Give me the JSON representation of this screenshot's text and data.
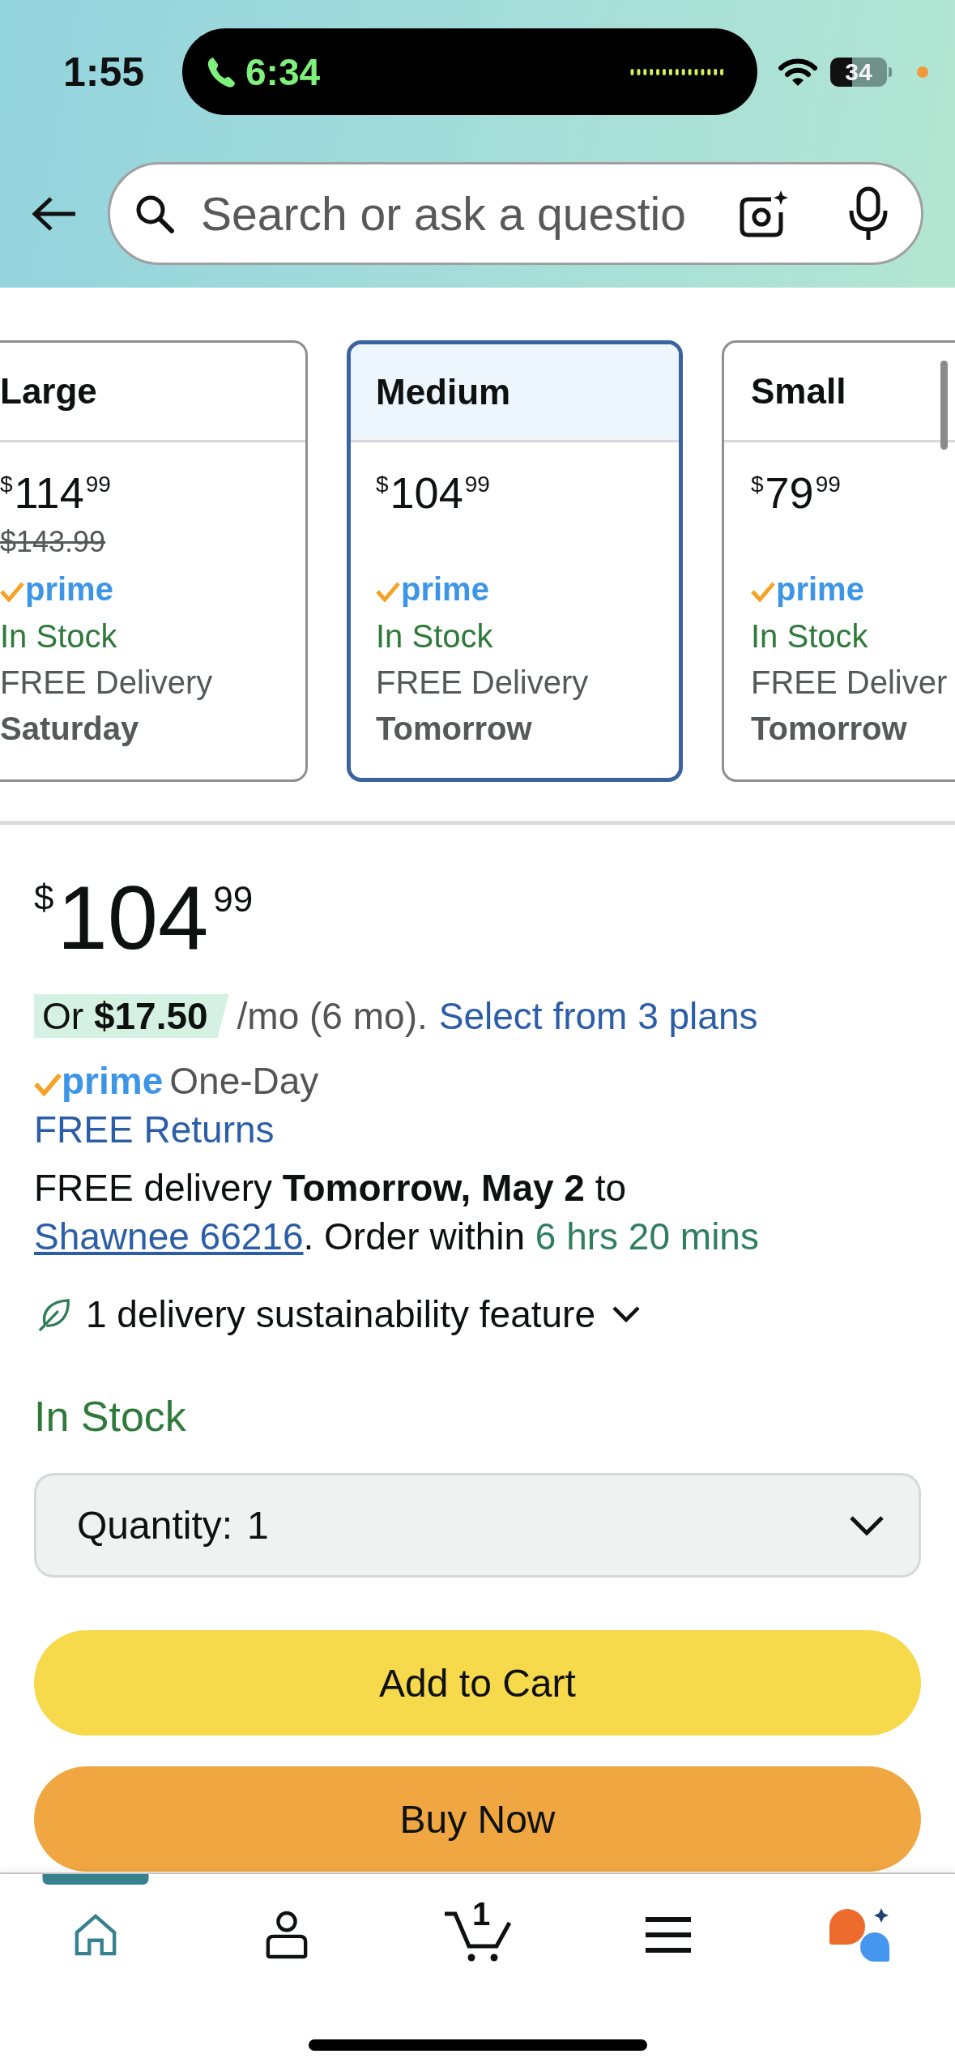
{
  "status_bar": {
    "time": "1:55",
    "call_duration": "6:34",
    "battery": "34"
  },
  "search": {
    "placeholder": "Search or ask a questio"
  },
  "size_options": [
    {
      "name": "Large",
      "price": {
        "symbol": "$",
        "whole": "114",
        "fraction": "99"
      },
      "list_price": "$143.99",
      "prime": "prime",
      "stock": "In Stock",
      "delivery": "FREE Delivery",
      "delivery_day": "Saturday",
      "selected": false
    },
    {
      "name": "Medium",
      "price": {
        "symbol": "$",
        "whole": "104",
        "fraction": "99"
      },
      "prime": "prime",
      "stock": "In Stock",
      "delivery": "FREE Delivery",
      "delivery_day": "Tomorrow",
      "selected": true
    },
    {
      "name": "Small",
      "price": {
        "symbol": "$",
        "whole": "79",
        "fraction": "99"
      },
      "prime": "prime",
      "stock": "In Stock",
      "delivery": "FREE Deliver",
      "delivery_day": "Tomorrow",
      "selected": false
    }
  ],
  "buy_box": {
    "price": {
      "symbol": "$",
      "whole": "104",
      "fraction": "99"
    },
    "installment": {
      "offer": "Or **$17.50**",
      "terms": "/mo (6 mo).",
      "link": "Select from 3 plans"
    },
    "prime": {
      "badge": "prime",
      "service": "One-Day"
    },
    "returns_link": "FREE Returns",
    "delivery": {
      "text": "FREE delivery **Tomorrow, May 2** to",
      "address_link": "Shawnee 66216",
      "order_text": ". Order within",
      "countdown": "6 hrs 20 mins"
    },
    "sustainability": {
      "label": "1 delivery sustainability feature",
      "expanded": false
    },
    "stock": "In Stock",
    "quantity": {
      "label": "Quantity:",
      "value": "1"
    },
    "buttons": [
      {
        "label": "Add to Cart",
        "kind": "cart"
      },
      {
        "label": "Buy Now",
        "kind": "buy"
      }
    ]
  },
  "tab_bar": [
    {
      "kind": "home",
      "selected": true
    },
    {
      "kind": "account",
      "selected": false
    },
    {
      "kind": "cart",
      "count": "1",
      "selected": false
    },
    {
      "kind": "menu",
      "selected": false
    },
    {
      "kind": "assistant",
      "selected": false
    }
  ]
}
